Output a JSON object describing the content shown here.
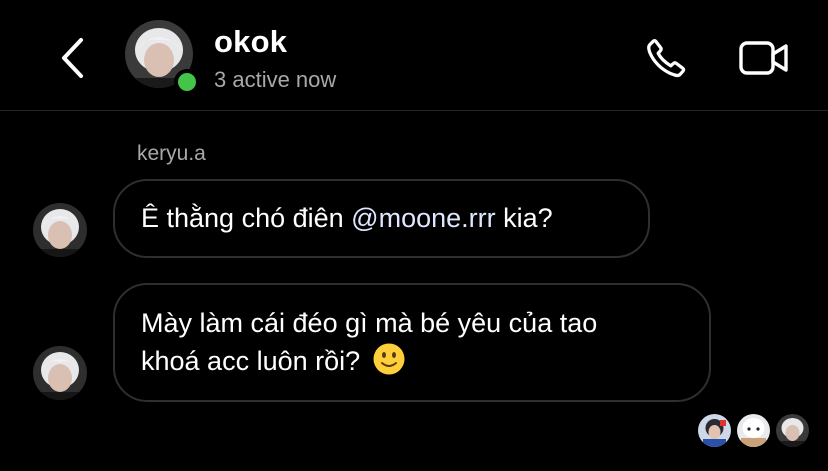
{
  "header": {
    "back_icon": "chevron-left-icon",
    "thread_name": "okok",
    "status": "3 active now",
    "online_color": "#44c54a",
    "call_icon": "phone-icon",
    "video_icon": "video-camera-icon"
  },
  "messages": [
    {
      "sender": "keryu.a",
      "text_before": "Ê thằng chó điên ",
      "mention": "@moone.rrr",
      "text_after": " kia?"
    },
    {
      "line1": "Mày làm cái đéo gì mà bé yêu của tao",
      "line2": "khoá acc luôn rồi? ",
      "emoji": "slightly-smiling-face-icon"
    }
  ],
  "seen_by": [
    "avatar",
    "avatar",
    "avatar"
  ]
}
